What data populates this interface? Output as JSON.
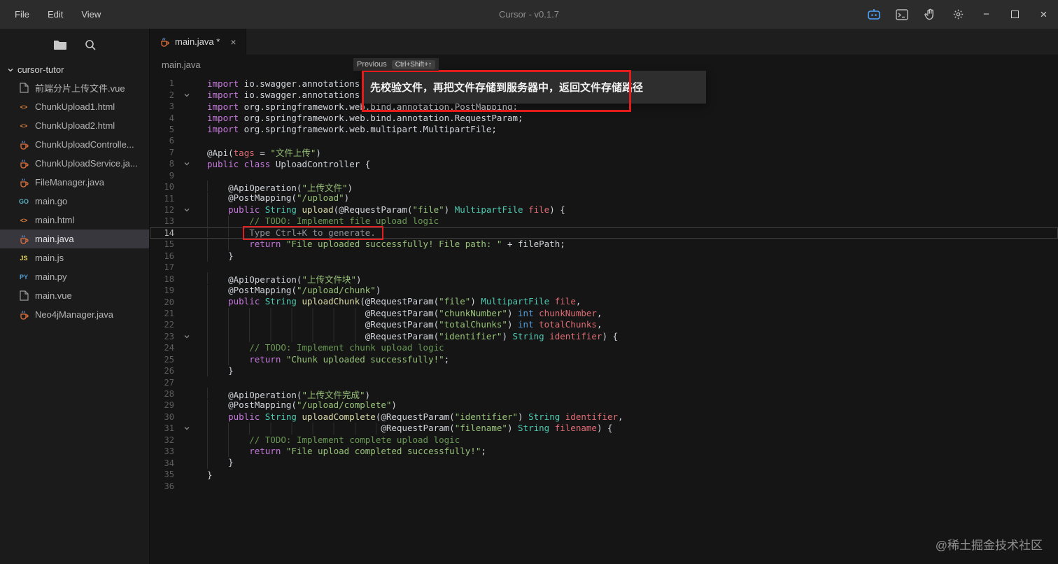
{
  "window": {
    "menus": [
      "File",
      "Edit",
      "View"
    ],
    "title": "Cursor - v0.1.7",
    "titlebar_icons": [
      "assistant",
      "terminal-panel",
      "hand",
      "settings"
    ],
    "window_controls": [
      "minimize",
      "maximize",
      "close"
    ]
  },
  "sidebar": {
    "toolbar_icons": [
      "folder",
      "search"
    ],
    "root_folder": "cursor-tutor",
    "files": [
      {
        "name": "前端分片上传文件.vue",
        "icon": "file"
      },
      {
        "name": "ChunkUpload1.html",
        "icon": "html"
      },
      {
        "name": "ChunkUpload2.html",
        "icon": "html"
      },
      {
        "name": "ChunkUploadControlle...",
        "icon": "java"
      },
      {
        "name": "ChunkUploadService.ja...",
        "icon": "java"
      },
      {
        "name": "FileManager.java",
        "icon": "java"
      },
      {
        "name": "main.go",
        "icon": "go"
      },
      {
        "name": "main.html",
        "icon": "html"
      },
      {
        "name": "main.java",
        "icon": "java",
        "selected": true
      },
      {
        "name": "main.js",
        "icon": "js"
      },
      {
        "name": "main.py",
        "icon": "py"
      },
      {
        "name": "main.vue",
        "icon": "file"
      },
      {
        "name": "Neo4jManager.java",
        "icon": "java"
      }
    ]
  },
  "editor": {
    "tab": {
      "label": "main.java *",
      "icon": "java",
      "close": "×"
    },
    "breadcrumb": "main.java",
    "lines": [
      {
        "n": 1,
        "ind": 0,
        "t": [
          [
            "k",
            "import"
          ],
          [
            "p",
            " io.swagger.annotations."
          ]
        ]
      },
      {
        "n": 2,
        "ind": 0,
        "fold": true,
        "t": [
          [
            "k",
            "import"
          ],
          [
            "p",
            " io.swagger.annotations."
          ]
        ]
      },
      {
        "n": 3,
        "ind": 0,
        "t": [
          [
            "k",
            "import"
          ],
          [
            "p",
            " org.springframework.web.bind.annotation.PostMapping;"
          ]
        ]
      },
      {
        "n": 4,
        "ind": 0,
        "t": [
          [
            "k",
            "import"
          ],
          [
            "p",
            " org.springframework.web.bind.annotation.RequestParam;"
          ]
        ]
      },
      {
        "n": 5,
        "ind": 0,
        "t": [
          [
            "k",
            "import"
          ],
          [
            "p",
            " org.springframework.web.multipart.MultipartFile;"
          ]
        ]
      },
      {
        "n": 6,
        "ind": 0,
        "t": []
      },
      {
        "n": 7,
        "ind": 0,
        "t": [
          [
            "p",
            "@Api("
          ],
          [
            "v",
            "tags"
          ],
          [
            "p",
            " = "
          ],
          [
            "s",
            "\"文件上传\""
          ],
          [
            "p",
            ")"
          ]
        ]
      },
      {
        "n": 8,
        "ind": 0,
        "fold": true,
        "t": [
          [
            "k",
            "public class"
          ],
          [
            "p",
            " UploadController {"
          ]
        ]
      },
      {
        "n": 9,
        "ind": 0,
        "t": []
      },
      {
        "n": 10,
        "ind": 4,
        "t": [
          [
            "p",
            "@ApiOperation("
          ],
          [
            "s",
            "\"上传文件\""
          ],
          [
            "p",
            ")"
          ]
        ]
      },
      {
        "n": 11,
        "ind": 4,
        "t": [
          [
            "p",
            "@PostMapping("
          ],
          [
            "s",
            "\"/upload\""
          ],
          [
            "p",
            ")"
          ]
        ]
      },
      {
        "n": 12,
        "ind": 4,
        "fold": true,
        "t": [
          [
            "k",
            "public"
          ],
          [
            "p",
            " "
          ],
          [
            "t",
            "String"
          ],
          [
            "p",
            " "
          ],
          [
            "f",
            "upload"
          ],
          [
            "p",
            "(@RequestParam("
          ],
          [
            "s",
            "\"file\""
          ],
          [
            "p",
            ") "
          ],
          [
            "t",
            "MultipartFile"
          ],
          [
            "p",
            " "
          ],
          [
            "v",
            "file"
          ],
          [
            "p",
            ") {"
          ]
        ]
      },
      {
        "n": 13,
        "ind": 8,
        "t": [
          [
            "c",
            "// TODO: Implement file upload logic"
          ]
        ]
      },
      {
        "n": 14,
        "ind": 8,
        "active": true,
        "kbox": true,
        "t": [
          [
            "g",
            "Type Ctrl+K to generate."
          ]
        ]
      },
      {
        "n": 15,
        "ind": 8,
        "t": [
          [
            "k",
            "return"
          ],
          [
            "p",
            " "
          ],
          [
            "s",
            "\"File uploaded successfully! File path: \""
          ],
          [
            "p",
            " + filePath;"
          ]
        ]
      },
      {
        "n": 16,
        "ind": 4,
        "t": [
          [
            "p",
            "}"
          ]
        ]
      },
      {
        "n": 17,
        "ind": 0,
        "t": []
      },
      {
        "n": 18,
        "ind": 4,
        "t": [
          [
            "p",
            "@ApiOperation("
          ],
          [
            "s",
            "\"上传文件块\""
          ],
          [
            "p",
            ")"
          ]
        ]
      },
      {
        "n": 19,
        "ind": 4,
        "t": [
          [
            "p",
            "@PostMapping("
          ],
          [
            "s",
            "\"/upload/chunk\""
          ],
          [
            "p",
            ")"
          ]
        ]
      },
      {
        "n": 20,
        "ind": 4,
        "t": [
          [
            "k",
            "public"
          ],
          [
            "p",
            " "
          ],
          [
            "t",
            "String"
          ],
          [
            "p",
            " "
          ],
          [
            "f",
            "uploadChunk"
          ],
          [
            "p",
            "(@RequestParam("
          ],
          [
            "s",
            "\"file\""
          ],
          [
            "p",
            ") "
          ],
          [
            "t",
            "MultipartFile"
          ],
          [
            "p",
            " "
          ],
          [
            "v",
            "file"
          ],
          [
            "p",
            ","
          ]
        ]
      },
      {
        "n": 21,
        "ind": 30,
        "t": [
          [
            "p",
            "@RequestParam("
          ],
          [
            "s",
            "\"chunkNumber\""
          ],
          [
            "p",
            ") "
          ],
          [
            "b",
            "int"
          ],
          [
            "p",
            " "
          ],
          [
            "v",
            "chunkNumber"
          ],
          [
            "p",
            ","
          ]
        ]
      },
      {
        "n": 22,
        "ind": 30,
        "t": [
          [
            "p",
            "@RequestParam("
          ],
          [
            "s",
            "\"totalChunks\""
          ],
          [
            "p",
            ") "
          ],
          [
            "b",
            "int"
          ],
          [
            "p",
            " "
          ],
          [
            "v",
            "totalChunks"
          ],
          [
            "p",
            ","
          ]
        ]
      },
      {
        "n": 23,
        "ind": 30,
        "fold": true,
        "t": [
          [
            "p",
            "@RequestParam("
          ],
          [
            "s",
            "\"identifier\""
          ],
          [
            "p",
            ") "
          ],
          [
            "t",
            "String"
          ],
          [
            "p",
            " "
          ],
          [
            "v",
            "identifier"
          ],
          [
            "p",
            ") {"
          ]
        ]
      },
      {
        "n": 24,
        "ind": 8,
        "t": [
          [
            "c",
            "// TODO: Implement chunk upload logic"
          ]
        ]
      },
      {
        "n": 25,
        "ind": 8,
        "t": [
          [
            "k",
            "return"
          ],
          [
            "p",
            " "
          ],
          [
            "s",
            "\"Chunk uploaded successfully!\""
          ],
          [
            "p",
            ";"
          ]
        ]
      },
      {
        "n": 26,
        "ind": 4,
        "t": [
          [
            "p",
            "}"
          ]
        ]
      },
      {
        "n": 27,
        "ind": 0,
        "t": []
      },
      {
        "n": 28,
        "ind": 4,
        "t": [
          [
            "p",
            "@ApiOperation("
          ],
          [
            "s",
            "\"上传文件完成\""
          ],
          [
            "p",
            ")"
          ]
        ]
      },
      {
        "n": 29,
        "ind": 4,
        "t": [
          [
            "p",
            "@PostMapping("
          ],
          [
            "s",
            "\"/upload/complete\""
          ],
          [
            "p",
            ")"
          ]
        ]
      },
      {
        "n": 30,
        "ind": 4,
        "t": [
          [
            "k",
            "public"
          ],
          [
            "p",
            " "
          ],
          [
            "t",
            "String"
          ],
          [
            "p",
            " "
          ],
          [
            "f",
            "uploadComplete"
          ],
          [
            "p",
            "(@RequestParam("
          ],
          [
            "s",
            "\"identifier\""
          ],
          [
            "p",
            ") "
          ],
          [
            "t",
            "String"
          ],
          [
            "p",
            " "
          ],
          [
            "v",
            "identifier"
          ],
          [
            "p",
            ","
          ]
        ]
      },
      {
        "n": 31,
        "ind": 33,
        "fold": true,
        "t": [
          [
            "p",
            "@RequestParam("
          ],
          [
            "s",
            "\"filename\""
          ],
          [
            "p",
            ") "
          ],
          [
            "t",
            "String"
          ],
          [
            "p",
            " "
          ],
          [
            "v",
            "filename"
          ],
          [
            "p",
            ") {"
          ]
        ]
      },
      {
        "n": 32,
        "ind": 8,
        "t": [
          [
            "c",
            "// TODO: Implement complete upload logic"
          ]
        ]
      },
      {
        "n": 33,
        "ind": 8,
        "t": [
          [
            "k",
            "return"
          ],
          [
            "p",
            " "
          ],
          [
            "s",
            "\"File upload completed successfully!\""
          ],
          [
            "p",
            ";"
          ]
        ]
      },
      {
        "n": 34,
        "ind": 4,
        "t": [
          [
            "p",
            "}"
          ]
        ]
      },
      {
        "n": 35,
        "ind": 0,
        "t": [
          [
            "p",
            "}"
          ]
        ]
      },
      {
        "n": 36,
        "ind": 0,
        "t": []
      }
    ]
  },
  "ai_tooltip": {
    "nav_label": "Previous",
    "nav_kbd": "Ctrl+Shift+↑",
    "annotation": "先校验文件，再把文件存储到服务器中，返回文件存储路径"
  },
  "watermark": "@稀土掘金技术社区",
  "colors": {
    "annotation_red": "#e31b1b",
    "assistant_blue": "#4da3ff",
    "string_green": "#98c379",
    "keyword_purple": "#c678dd"
  }
}
